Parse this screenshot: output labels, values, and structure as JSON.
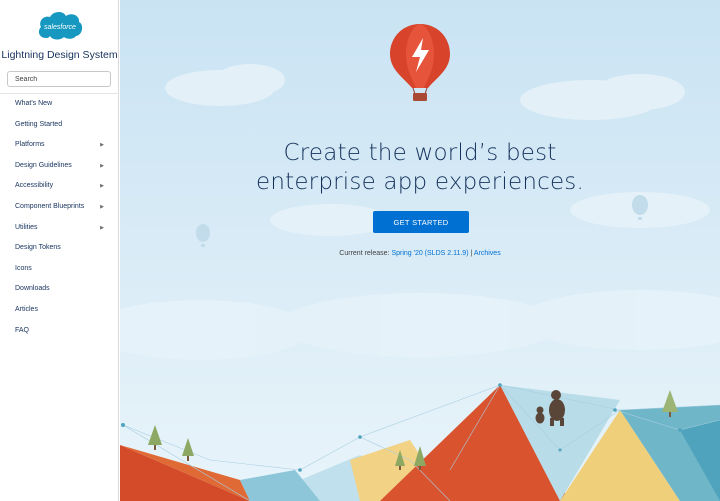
{
  "sidebar": {
    "logo_text": "salesforce",
    "app_title": "Lightning Design System",
    "search_placeholder": "Search",
    "items": [
      {
        "label": "What's New",
        "expandable": false
      },
      {
        "label": "Getting Started",
        "expandable": false
      },
      {
        "label": "Platforms",
        "expandable": true
      },
      {
        "label": "Design Guidelines",
        "expandable": true
      },
      {
        "label": "Accessibility",
        "expandable": true
      },
      {
        "label": "Component Blueprints",
        "expandable": true
      },
      {
        "label": "Utilities",
        "expandable": true
      },
      {
        "label": "Design Tokens",
        "expandable": false
      },
      {
        "label": "Icons",
        "expandable": false
      },
      {
        "label": "Downloads",
        "expandable": false
      },
      {
        "label": "Articles",
        "expandable": false
      },
      {
        "label": "FAQ",
        "expandable": false
      }
    ]
  },
  "hero": {
    "headline_line1": "Create the world’s best",
    "headline_line2": "enterprise app experiences.",
    "cta_label": "GET STARTED",
    "release_prefix": "Current release: ",
    "release_link": "Spring '20 (SLDS 2.11.9)",
    "release_separator": " | ",
    "archives_link": "Archives"
  },
  "colors": {
    "brand_blue": "#0070d2",
    "navy_text": "#16325c",
    "sky": "#cfe6f4",
    "balloon_red": "#d8432b"
  },
  "icons": {
    "logo": "salesforce-cloud-logo",
    "balloon": "lightning-hot-air-balloon",
    "caret": "caret-right-icon"
  }
}
